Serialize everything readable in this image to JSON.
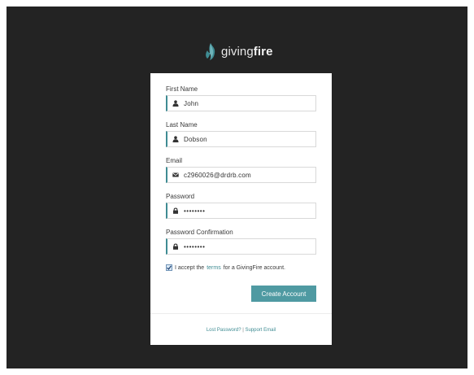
{
  "logo": {
    "text_light": "giving",
    "text_bold": "fire",
    "icon": "flame-icon",
    "color": "#3f8c93"
  },
  "form": {
    "fields": [
      {
        "label": "First Name",
        "value": "John",
        "icon": "user-icon"
      },
      {
        "label": "Last Name",
        "value": "Dobson",
        "icon": "user-icon"
      },
      {
        "label": "Email",
        "value": "c2960026@drdrb.com",
        "icon": "envelope-icon"
      },
      {
        "label": "Password",
        "value": "••••••••",
        "icon": "lock-icon"
      },
      {
        "label": "Password Confirmation",
        "value": "••••••••",
        "icon": "lock-icon"
      }
    ],
    "terms": {
      "checked": true,
      "prefix": "I accept the",
      "link": "terms",
      "suffix": "for a GivingFire account."
    },
    "submit_label": "Create Account"
  },
  "footer": {
    "lost_password": "Lost Password?",
    "separator": "|",
    "support_email": "Support Email"
  },
  "colors": {
    "background": "#232323",
    "accent": "#3f8c93",
    "button": "#4f9aa2"
  }
}
